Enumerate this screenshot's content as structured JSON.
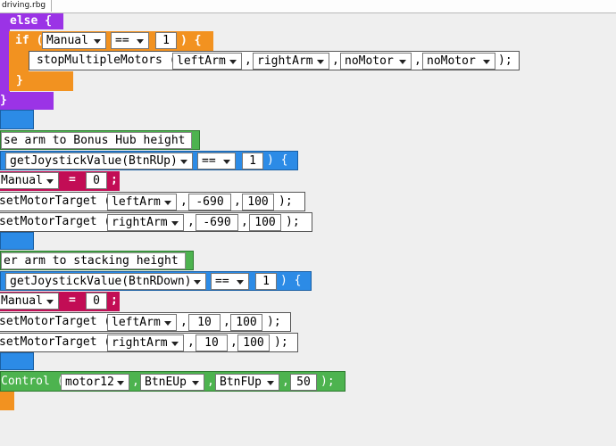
{
  "tab": {
    "filename": "driving.rbg"
  },
  "else_block": {
    "keyword": "else {",
    "close": "}"
  },
  "if_block": {
    "if_kw": "if (",
    "variable": "Manual",
    "operator": "==",
    "value": "1",
    "close_paren": ") {",
    "close_brace": "}"
  },
  "stop_motors": {
    "func": "stopMultipleMotors (",
    "args": [
      "leftArm",
      "rightArm",
      "noMotor",
      "noMotor"
    ],
    "comma": ",",
    "end": ");"
  },
  "section1": {
    "comment": "se arm to Bonus Hub height",
    "cond_func": "getJoystickValue(BtnRUp)",
    "cond_op": "==",
    "cond_val": "1",
    "cond_close": ") {",
    "assign_var": "Manual",
    "assign_eq": "=",
    "assign_val": "0",
    "assign_end": ";",
    "targets": [
      {
        "func": "setMotorTarget (",
        "motor": "leftArm",
        "pos": "-690",
        "speed": "100",
        "end": ");"
      },
      {
        "func": "setMotorTarget (",
        "motor": "rightArm",
        "pos": "-690",
        "speed": "100",
        "end": ");"
      }
    ]
  },
  "section2": {
    "comment": "er arm to stacking height",
    "cond_func": "getJoystickValue(BtnRDown)",
    "cond_op": "==",
    "cond_val": "1",
    "cond_close": ") {",
    "assign_var": "Manual",
    "assign_eq": "=",
    "assign_val": "0",
    "assign_end": ";",
    "targets": [
      {
        "func": "setMotorTarget (",
        "motor": "leftArm",
        "pos": "10",
        "speed": "100",
        "end": ");"
      },
      {
        "func": "setMotorTarget (",
        "motor": "rightArm",
        "pos": "10",
        "speed": "100",
        "end": ");"
      }
    ]
  },
  "control": {
    "func": "Control (",
    "motor": "motor12",
    "btn1": "BtnEUp",
    "btn2": "BtnFUp",
    "speed": "50",
    "end": ");",
    "comma": ","
  },
  "colors": {
    "purple": "#9b33e6",
    "orange": "#f29220",
    "blue": "#2c8be6",
    "green": "#4db34f",
    "crimson": "#c20d55"
  }
}
